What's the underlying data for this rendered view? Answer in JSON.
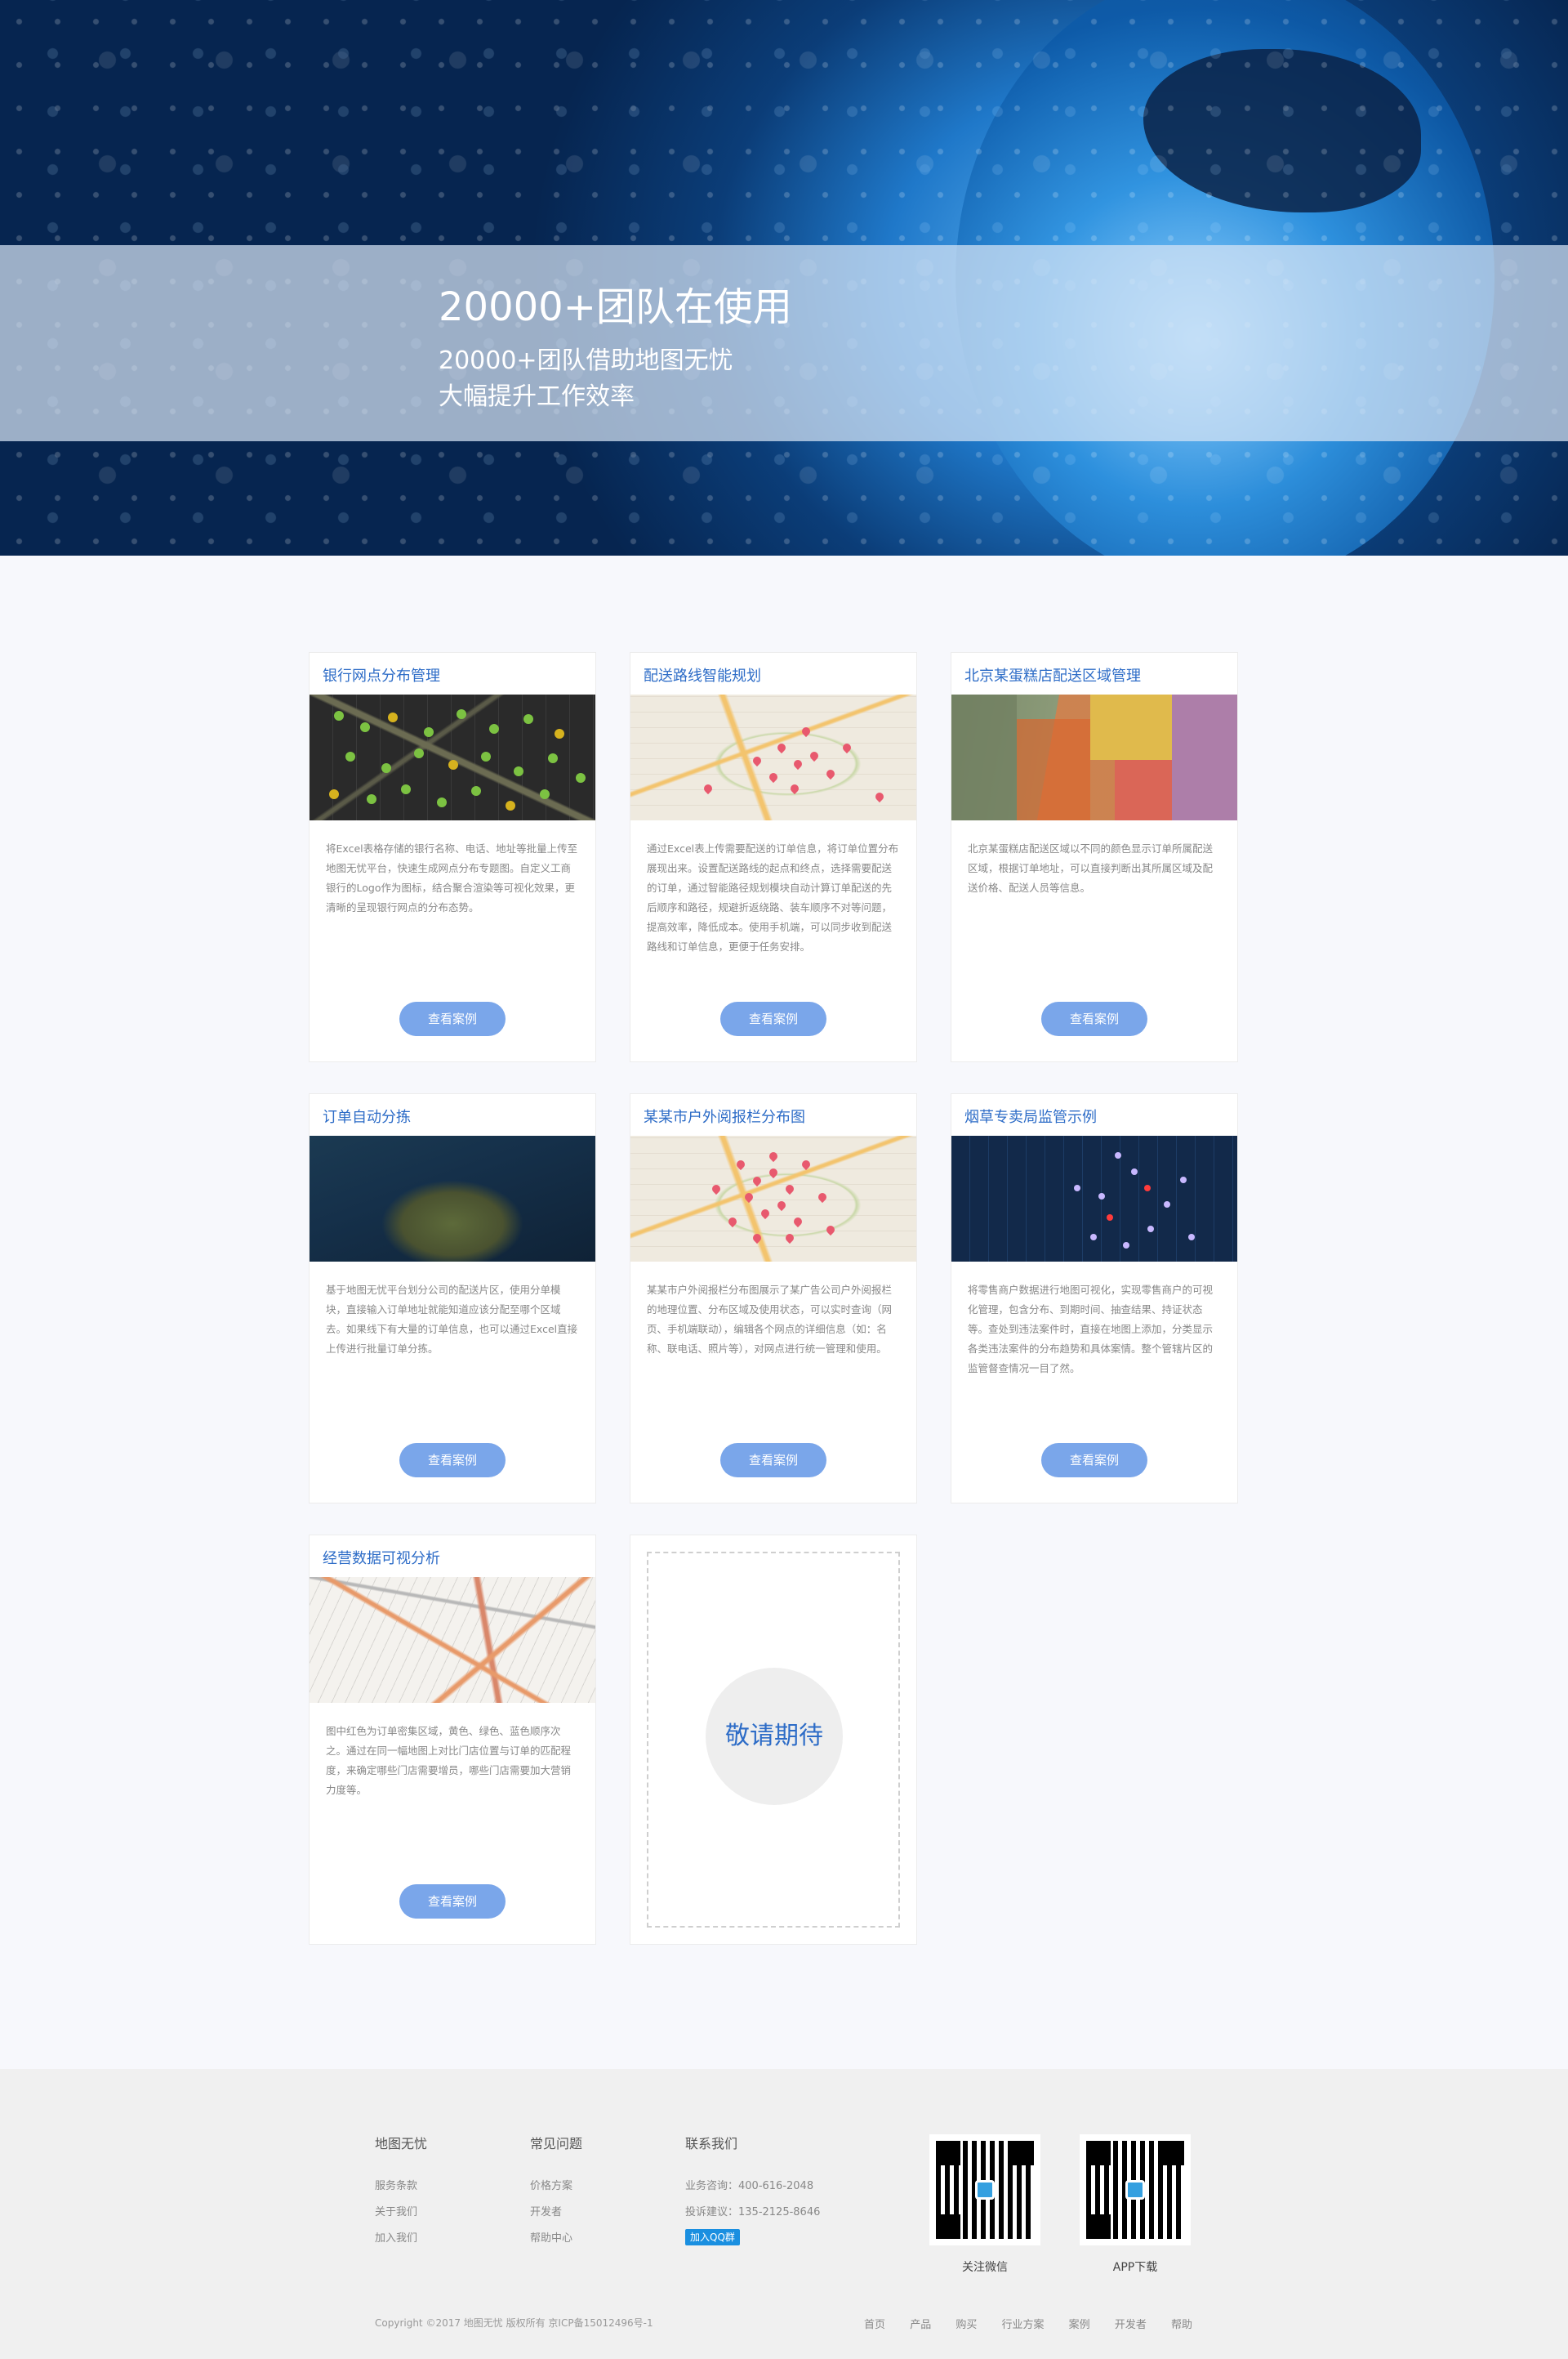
{
  "hero": {
    "title": "20000+团队在使用",
    "subtitle_line1": "20000+团队借助地图无忧",
    "subtitle_line2": "大幅提升工作效率"
  },
  "cards": [
    {
      "title": "银行网点分布管理",
      "desc": "将Excel表格存储的银行名称、电话、地址等批量上传至地图无忧平台，快速生成网点分布专题图。自定义工商银行的Logo作为图标，结合聚合渲染等可视化效果，更清晰的呈现银行网点的分布态势。",
      "button": "查看案例"
    },
    {
      "title": "配送路线智能规划",
      "desc": "通过Excel表上传需要配送的订单信息，将订单位置分布展现出来。设置配送路线的起点和终点，选择需要配送的订单，通过智能路径规划模块自动计算订单配送的先后顺序和路径，规避折返绕路、装车顺序不对等问题，提高效率，降低成本。使用手机端，可以同步收到配送路线和订单信息，更便于任务安排。",
      "button": "查看案例"
    },
    {
      "title": "北京某蛋糕店配送区域管理",
      "desc": "北京某蛋糕店配送区域以不同的颜色显示订单所属配送区域，根据订单地址，可以直接判断出其所属区域及配送价格、配送人员等信息。",
      "button": "查看案例"
    },
    {
      "title": "订单自动分拣",
      "desc": "基于地图无忧平台划分公司的配送片区，使用分单模块，直接输入订单地址就能知道应该分配至哪个区域去。如果线下有大量的订单信息，也可以通过Excel直接上传进行批量订单分拣。",
      "button": "查看案例"
    },
    {
      "title": "某某市户外阅报栏分布图",
      "desc": "某某市户外阅报栏分布图展示了某广告公司户外阅报栏的地理位置、分布区域及使用状态，可以实时查询（网页、手机端联动），编辑各个网点的详细信息（如：名称、联电话、照片等），对网点进行统一管理和使用。",
      "button": "查看案例"
    },
    {
      "title": "烟草专卖局监管示例",
      "desc": "将零售商户数据进行地图可视化，实现零售商户的可视化管理，包含分布、到期时间、抽查结果、持证状态等。查处到违法案件时，直接在地图上添加，分类显示各类违法案件的分布趋势和具体案情。整个管辖片区的监管督查情况一目了然。",
      "button": "查看案例"
    },
    {
      "title": "经营数据可视分析",
      "desc": "图中红色为订单密集区域，黄色、绿色、蓝色顺序次之。通过在同一幅地图上对比门店位置与订单的匹配程度，来确定哪些门店需要增员，哪些门店需要加大营销力度等。",
      "button": "查看案例"
    }
  ],
  "placeholder": {
    "text": "敬请期待"
  },
  "footer": {
    "col1": {
      "title": "地图无忧",
      "links": [
        "服务条款",
        "关于我们",
        "加入我们"
      ]
    },
    "col2": {
      "title": "常见问题",
      "links": [
        "价格方案",
        "开发者",
        "帮助中心"
      ]
    },
    "col3": {
      "title": "联系我们",
      "phone": "业务咨询：400-616-2048",
      "complaint": "投诉建议：135-2125-8646",
      "qq_button": "加入QQ群"
    },
    "qr_wechat_label": "关注微信",
    "qr_app_label": "APP下载",
    "copyright": "Copyright ©2017 地图无忧 版权所有 京ICP备15012496号-1",
    "nav": [
      "首页",
      "产品",
      "购买",
      "行业方案",
      "案例",
      "开发者",
      "帮助"
    ]
  }
}
